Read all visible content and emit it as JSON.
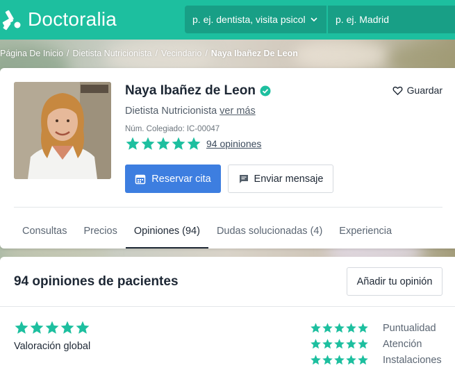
{
  "header": {
    "brand": "Doctoralia",
    "search_specialty": "p. ej. dentista, visita psicol",
    "search_location": "p. ej. Madrid",
    "brand_color": "#1dbf9f"
  },
  "breadcrumb": {
    "items": [
      "Página De Inicio",
      "Dietista Nutricionista",
      "Vecindario"
    ],
    "current": "Naya Ibañez De Leon"
  },
  "profile": {
    "name": "Naya Ibañez de Leon",
    "verified_icon": "verified-check-icon",
    "save_label": "Guardar",
    "specialty": "Dietista Nutricionista",
    "more_link": "ver más",
    "license": "Núm. Colegiado: IC-00047",
    "rating_stars": 5,
    "reviews_link": "94 opiniones",
    "book_button": "Reservar cita",
    "message_button": "Enviar mensaje",
    "accent_color": "#3d7ee0",
    "star_color": "#1dbf9f"
  },
  "tabs": [
    {
      "label": "Consultas",
      "active": false
    },
    {
      "label": "Precios",
      "active": false
    },
    {
      "label": "Opiniones (94)",
      "active": true
    },
    {
      "label": "Dudas solucionadas (4)",
      "active": false
    },
    {
      "label": "Experiencia",
      "active": false
    }
  ],
  "reviews": {
    "title": "94 opiniones de pacientes",
    "add_button": "Añadir tu opinión",
    "global_label": "Valoración global",
    "global_stars": 5,
    "sub_ratings": [
      {
        "label": "Puntualidad",
        "stars": 5
      },
      {
        "label": "Atención",
        "stars": 5
      },
      {
        "label": "Instalaciones",
        "stars": 5
      }
    ]
  }
}
